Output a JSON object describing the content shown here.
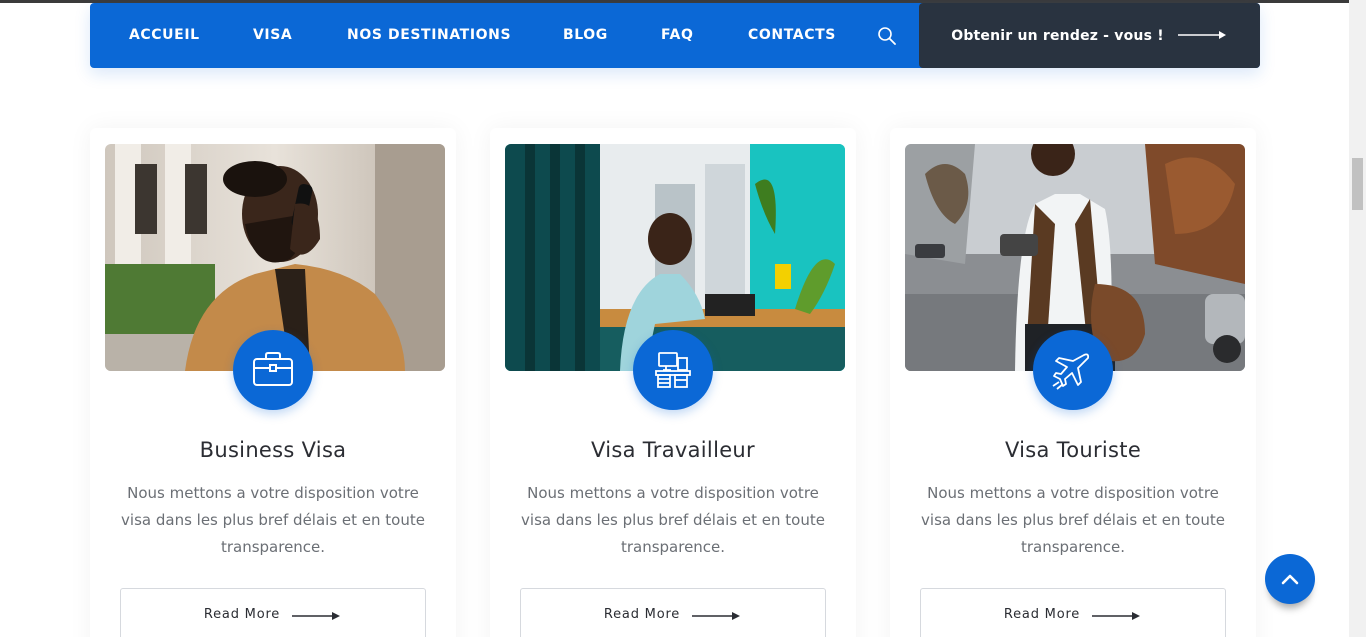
{
  "nav": {
    "items": [
      {
        "label": "ACCUEIL"
      },
      {
        "label": "VISA"
      },
      {
        "label": "NOS DESTINATIONS"
      },
      {
        "label": "BLOG"
      },
      {
        "label": "FAQ"
      },
      {
        "label": "CONTACTS"
      }
    ],
    "search_icon": "search-icon",
    "cta_label": "Obtenir un rendez - vous !",
    "cta_icon": "arrow-right-icon"
  },
  "cards": [
    {
      "title": "Business Visa",
      "description": "Nous mettons a votre disposition votre visa dans les plus bref délais et en toute transparence.",
      "icon": "briefcase-icon",
      "button_label": "Read More"
    },
    {
      "title": "Visa Travailleur",
      "description": "Nous mettons a votre disposition votre visa dans les plus bref délais et en toute transparence.",
      "icon": "workdesk-icon",
      "button_label": "Read More"
    },
    {
      "title": "Visa Touriste",
      "description": "Nous mettons a votre disposition votre visa dans les plus bref délais et en toute transparence.",
      "icon": "airplane-icon",
      "button_label": "Read More"
    }
  ],
  "back_to_top_icon": "chevron-up-icon",
  "colors": {
    "primary": "#0b68d6",
    "cta_background": "#293340",
    "heading": "#2b2d33",
    "body_text": "#6b6f75"
  }
}
